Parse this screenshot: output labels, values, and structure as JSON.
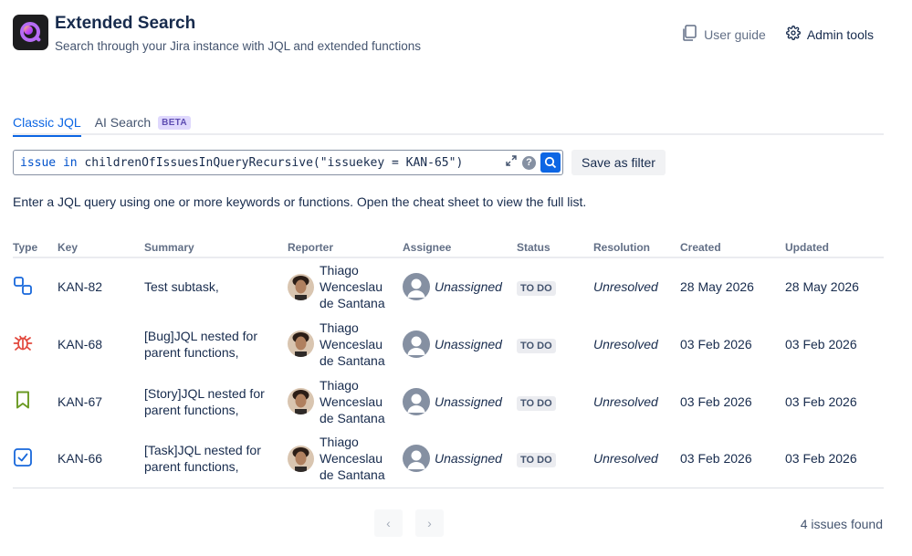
{
  "app": {
    "title": "Extended Search",
    "subtitle": "Search through your Jira instance with JQL and extended functions"
  },
  "header_actions": {
    "user_guide": "User guide",
    "admin_tools": "Admin tools"
  },
  "tabs": [
    {
      "label": "Classic JQL",
      "active": true
    },
    {
      "label": "AI Search",
      "badge": "BETA",
      "active": false
    }
  ],
  "query": {
    "keyword_issue": "issue",
    "keyword_in": "in",
    "function_text": "childrenOfIssuesInQueryRecursive(\"issuekey = KAN-65\")",
    "help_symbol": "?"
  },
  "save_filter_label": "Save as filter",
  "hint": "Enter a JQL query using one or more keywords or functions. Open the cheat sheet to view the full list.",
  "columns": {
    "type": "Type",
    "key": "Key",
    "summary": "Summary",
    "reporter": "Reporter",
    "assignee": "Assignee",
    "status": "Status",
    "resolution": "Resolution",
    "created": "Created",
    "updated": "Updated"
  },
  "rows": [
    {
      "type_icon": "subtask-icon",
      "key": "KAN-82",
      "summary": "Test subtask,",
      "reporter": "Thiago Wenceslau de Santana",
      "assignee": "Unassigned",
      "status": "TO DO",
      "resolution": "Unresolved",
      "created": "28 May 2026",
      "updated": "28 May 2026"
    },
    {
      "type_icon": "bug-icon",
      "key": "KAN-68",
      "summary": "[Bug]JQL nested for parent functions,",
      "reporter": "Thiago Wenceslau de Santana",
      "assignee": "Unassigned",
      "status": "TO DO",
      "resolution": "Unresolved",
      "created": "03 Feb 2026",
      "updated": "03 Feb 2026"
    },
    {
      "type_icon": "story-icon",
      "key": "KAN-67",
      "summary": "[Story]JQL nested for parent functions,",
      "reporter": "Thiago Wenceslau de Santana",
      "assignee": "Unassigned",
      "status": "TO DO",
      "resolution": "Unresolved",
      "created": "03 Feb 2026",
      "updated": "03 Feb 2026"
    },
    {
      "type_icon": "task-icon",
      "key": "KAN-66",
      "summary": "[Task]JQL nested for parent functions,",
      "reporter": "Thiago Wenceslau de Santana",
      "assignee": "Unassigned",
      "status": "TO DO",
      "resolution": "Unresolved",
      "created": "03 Feb 2026",
      "updated": "03 Feb 2026"
    }
  ],
  "pagination": {
    "prev": "‹",
    "next": "›"
  },
  "result_count": "4 issues found",
  "colors": {
    "accent": "#0c66e4",
    "subtask": "#1868db",
    "bug": "#e2483d",
    "story": "#6a9a23",
    "task": "#1868db",
    "beta_bg": "#dfd8fd",
    "beta_text": "#5e4db2"
  }
}
